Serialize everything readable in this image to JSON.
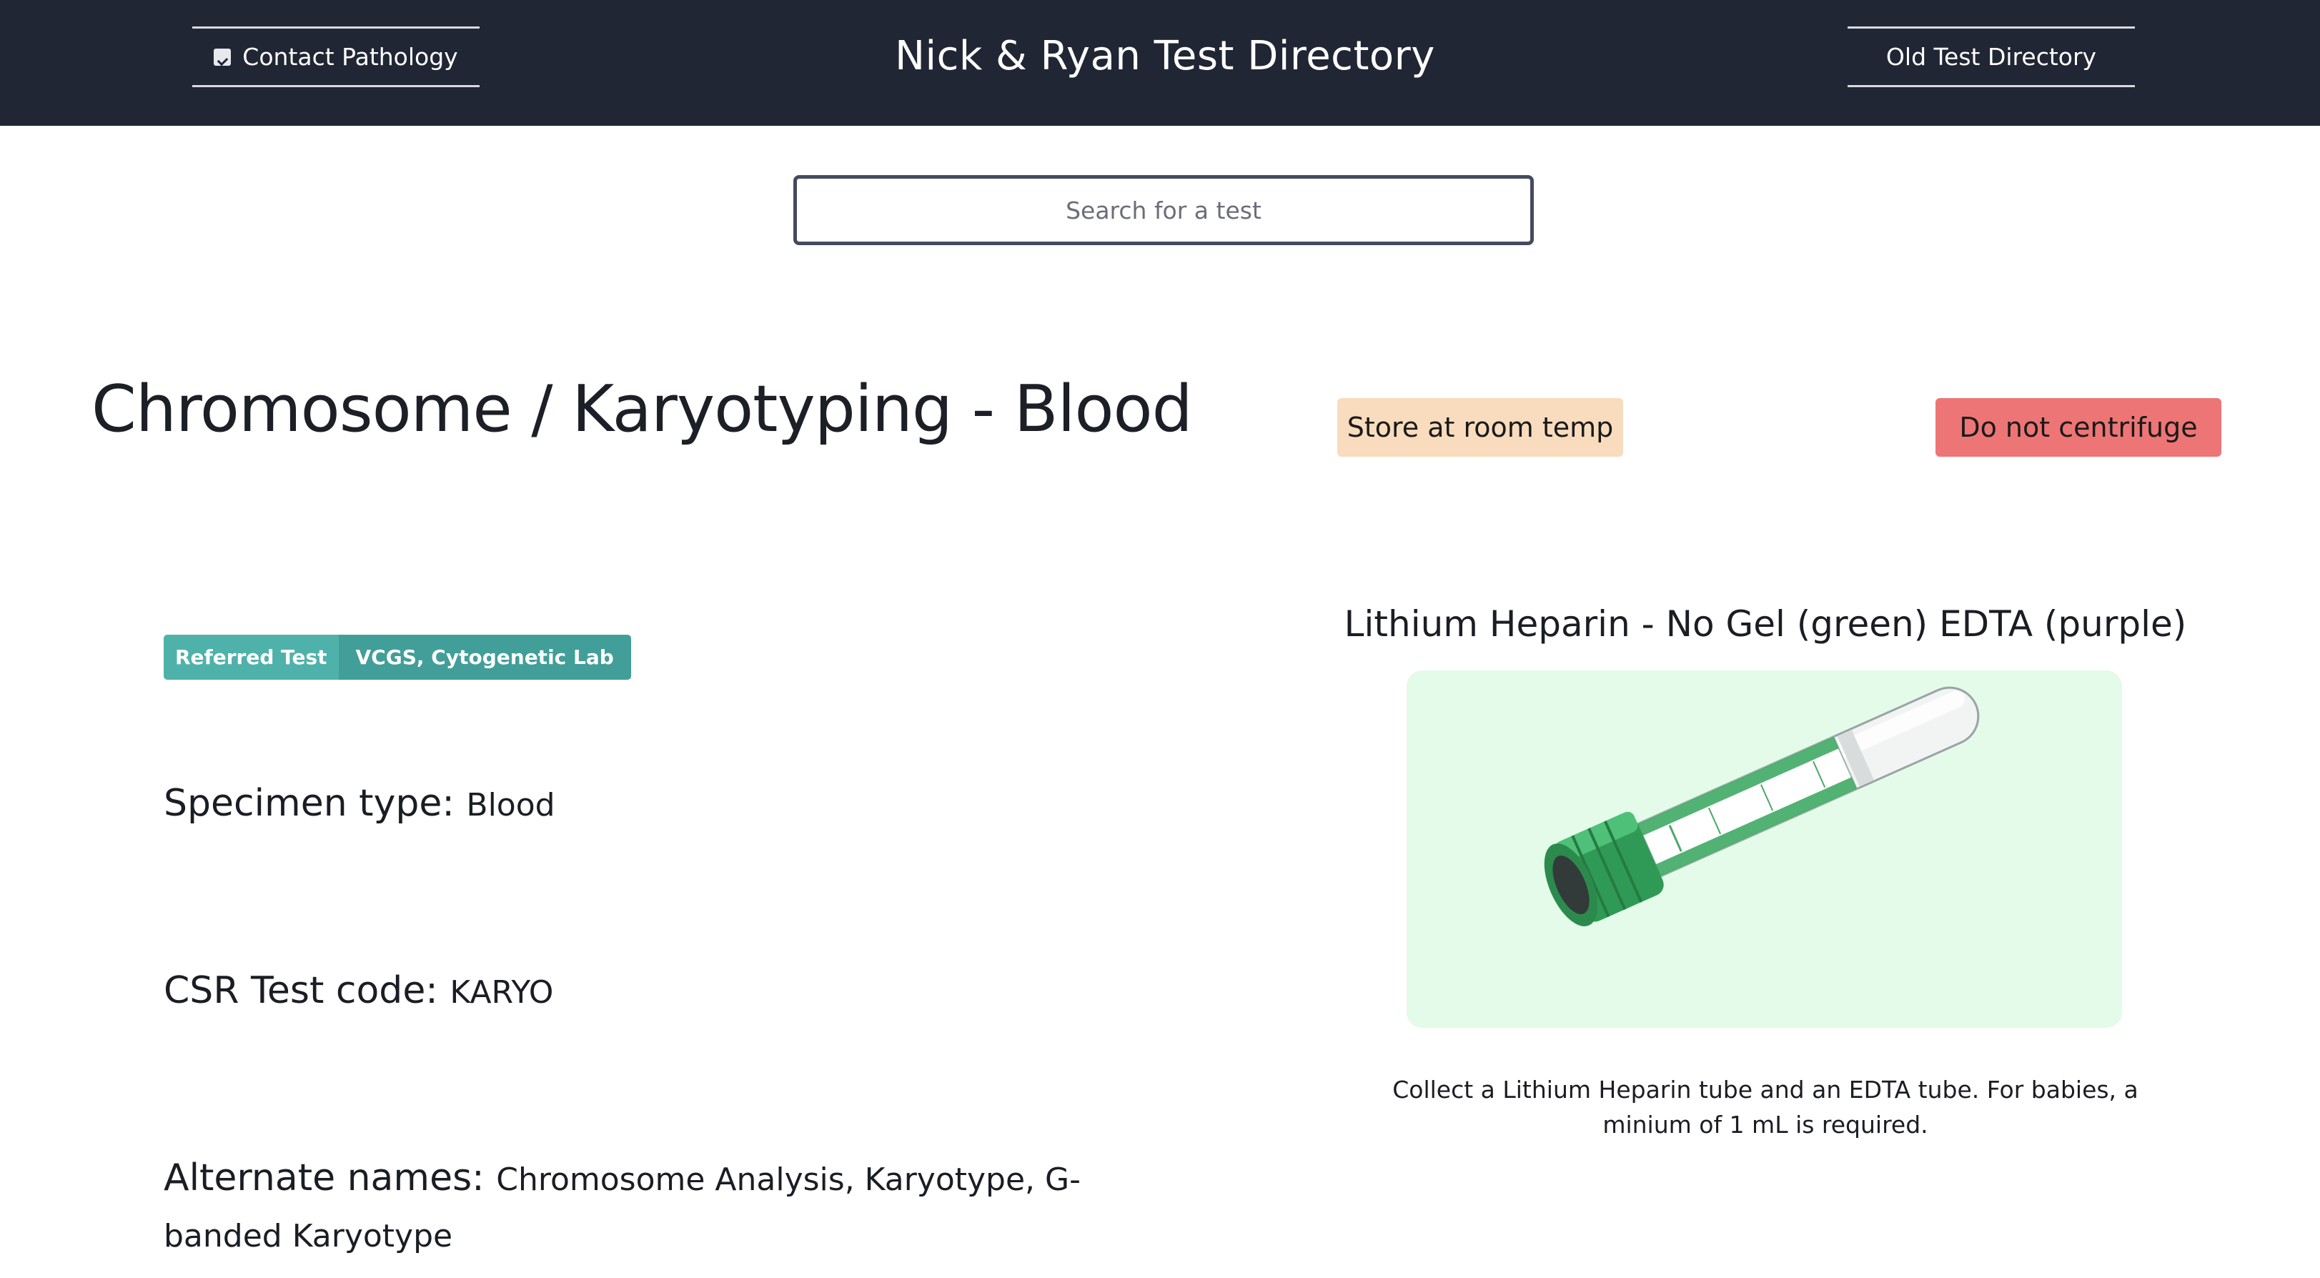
{
  "header": {
    "contact_label": "Contact Pathology",
    "site_title": "Nick & Ryan Test Directory",
    "old_directory_label": "Old Test Directory",
    "background": "#212634"
  },
  "search": {
    "placeholder": "Search for a test"
  },
  "test": {
    "title": "Chromosome / Karyotyping - Blood",
    "badges": {
      "storage": "Store at room temp",
      "storage_color": "#f8dcbd",
      "centrifuge": "Do not centrifuge",
      "centrifuge_color": "#ee7575"
    },
    "referral": {
      "type": "Referred Test",
      "lab": "VCGS, Cytogenetic Lab"
    },
    "specimen_label": "Specimen type:",
    "specimen_value": "Blood",
    "code_label": "CSR Test code:",
    "code_value": "KARYO",
    "alt_label": "Alternate names:",
    "alt_value": "Chromosome Analysis, Karyotype, G-banded Karyotype"
  },
  "tube": {
    "title": "Lithium Heparin - No Gel (green) EDTA (purple)",
    "image_icon": "lithium-heparin-tube",
    "caption": "Collect a Lithium Heparin tube and an EDTA tube. For babies, a minium of 1 mL is required."
  }
}
